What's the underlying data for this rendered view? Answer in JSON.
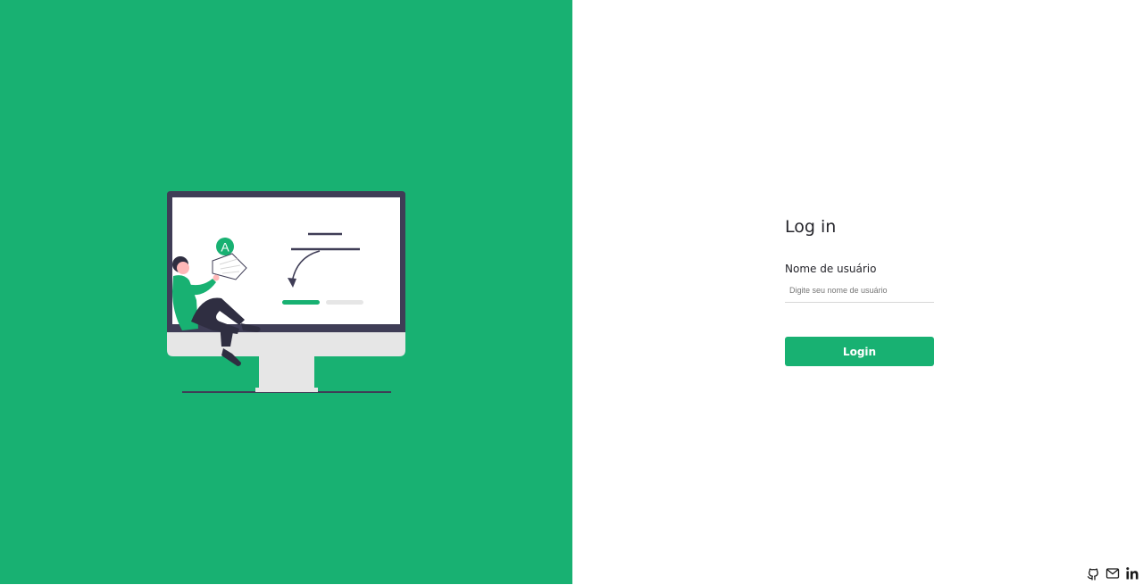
{
  "illustration": {
    "badge_letter": "A",
    "colors": {
      "accent": "#18b172",
      "dark": "#3f3d56",
      "screen": "#ffffff",
      "stand": "#e6e6e6"
    }
  },
  "login": {
    "title": "Log in",
    "username_label": "Nome de usuário",
    "username_placeholder": "Digite seu nome de usuário",
    "username_value": "",
    "submit_label": "Login"
  },
  "footer": {
    "icons": [
      "github-icon",
      "mail-icon",
      "linkedin-icon"
    ]
  },
  "colors": {
    "brand": "#18b172",
    "text": "#26262c"
  }
}
